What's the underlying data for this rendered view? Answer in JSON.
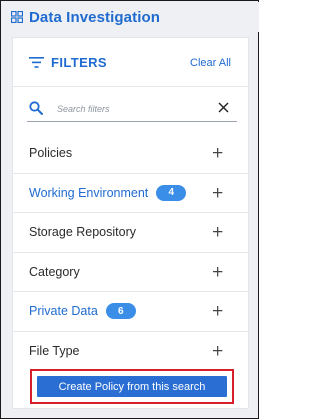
{
  "header": {
    "title": "Data Investigation",
    "icon": "grid-icon"
  },
  "filters": {
    "title": "FILTERS",
    "clear_label": "Clear All",
    "icon": "filter-lines-icon"
  },
  "search": {
    "placeholder": "Search filters",
    "value": "",
    "icon": "search-icon",
    "clear_icon": "close-icon"
  },
  "filter_items": [
    {
      "label": "Policies",
      "badge": "",
      "active": false
    },
    {
      "label": "Working Environment",
      "badge": "4",
      "active": true
    },
    {
      "label": "Storage Repository",
      "badge": "",
      "active": false
    },
    {
      "label": "Category",
      "badge": "",
      "active": false
    },
    {
      "label": "Private Data",
      "badge": "6",
      "active": true
    },
    {
      "label": "File Type",
      "badge": "",
      "active": false
    }
  ],
  "expand_symbol": "+",
  "cta": {
    "label": "Create Policy from this search"
  },
  "colors": {
    "accent": "#1f6bd0",
    "badge": "#3b8ee8",
    "highlight": "#d8202a",
    "button": "#2a6ed3"
  }
}
